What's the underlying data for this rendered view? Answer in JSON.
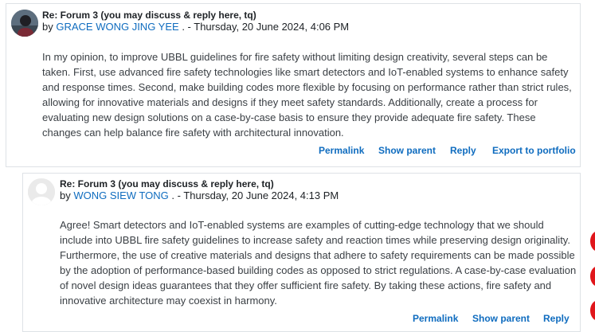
{
  "posts": [
    {
      "subject": "Re: Forum 3 (you may discuss & reply here, tq)",
      "by": "by",
      "author": "GRACE WONG JING YEE",
      "date_sep": ". - Thursday, 20 June 2024, 4:06 PM",
      "body": "In my opinion, to improve UBBL guidelines for fire safety without limiting design creativity, several steps can be taken. First, use advanced fire safety technologies like smart detectors and IoT-enabled systems to enhance safety and response times. Second, make building codes more flexible by focusing on performance rather than strict rules, allowing for innovative materials and designs if they meet safety standards. Additionally, create a process for evaluating new design solutions on a case-by-case basis to ensure they provide adequate fire safety. These changes can help balance fire safety with architectural innovation.",
      "actions": {
        "permalink": "Permalink",
        "show_parent": "Show parent",
        "reply": "Reply",
        "export": "Export to portfolio"
      }
    },
    {
      "subject": "Re: Forum 3 (you may discuss & reply here, tq)",
      "by": "by",
      "author": "WONG SIEW TONG",
      "date_sep": ". - Thursday, 20 June 2024, 4:13 PM",
      "body": "Agree! Smart detectors and IoT-enabled systems are examples of cutting-edge technology that we should include into UBBL fire safety guidelines to increase safety and reaction times while preserving design originality. Furthermore, the use of creative materials and designs that adhere to safety requirements can be made possible by the adoption of performance-based building codes as opposed to strict regulations. A case-by-case evaluation of novel design ideas guarantees that they offer sufficient fire safety. By taking these actions, fire safety and innovative architecture may coexist in harmony.",
      "actions": {
        "permalink": "Permalink",
        "show_parent": "Show parent",
        "reply": "Reply"
      }
    }
  ],
  "colors": {
    "link": "#0f6cbf",
    "border": "#dee2e6",
    "side_marker": "#e0161b"
  }
}
